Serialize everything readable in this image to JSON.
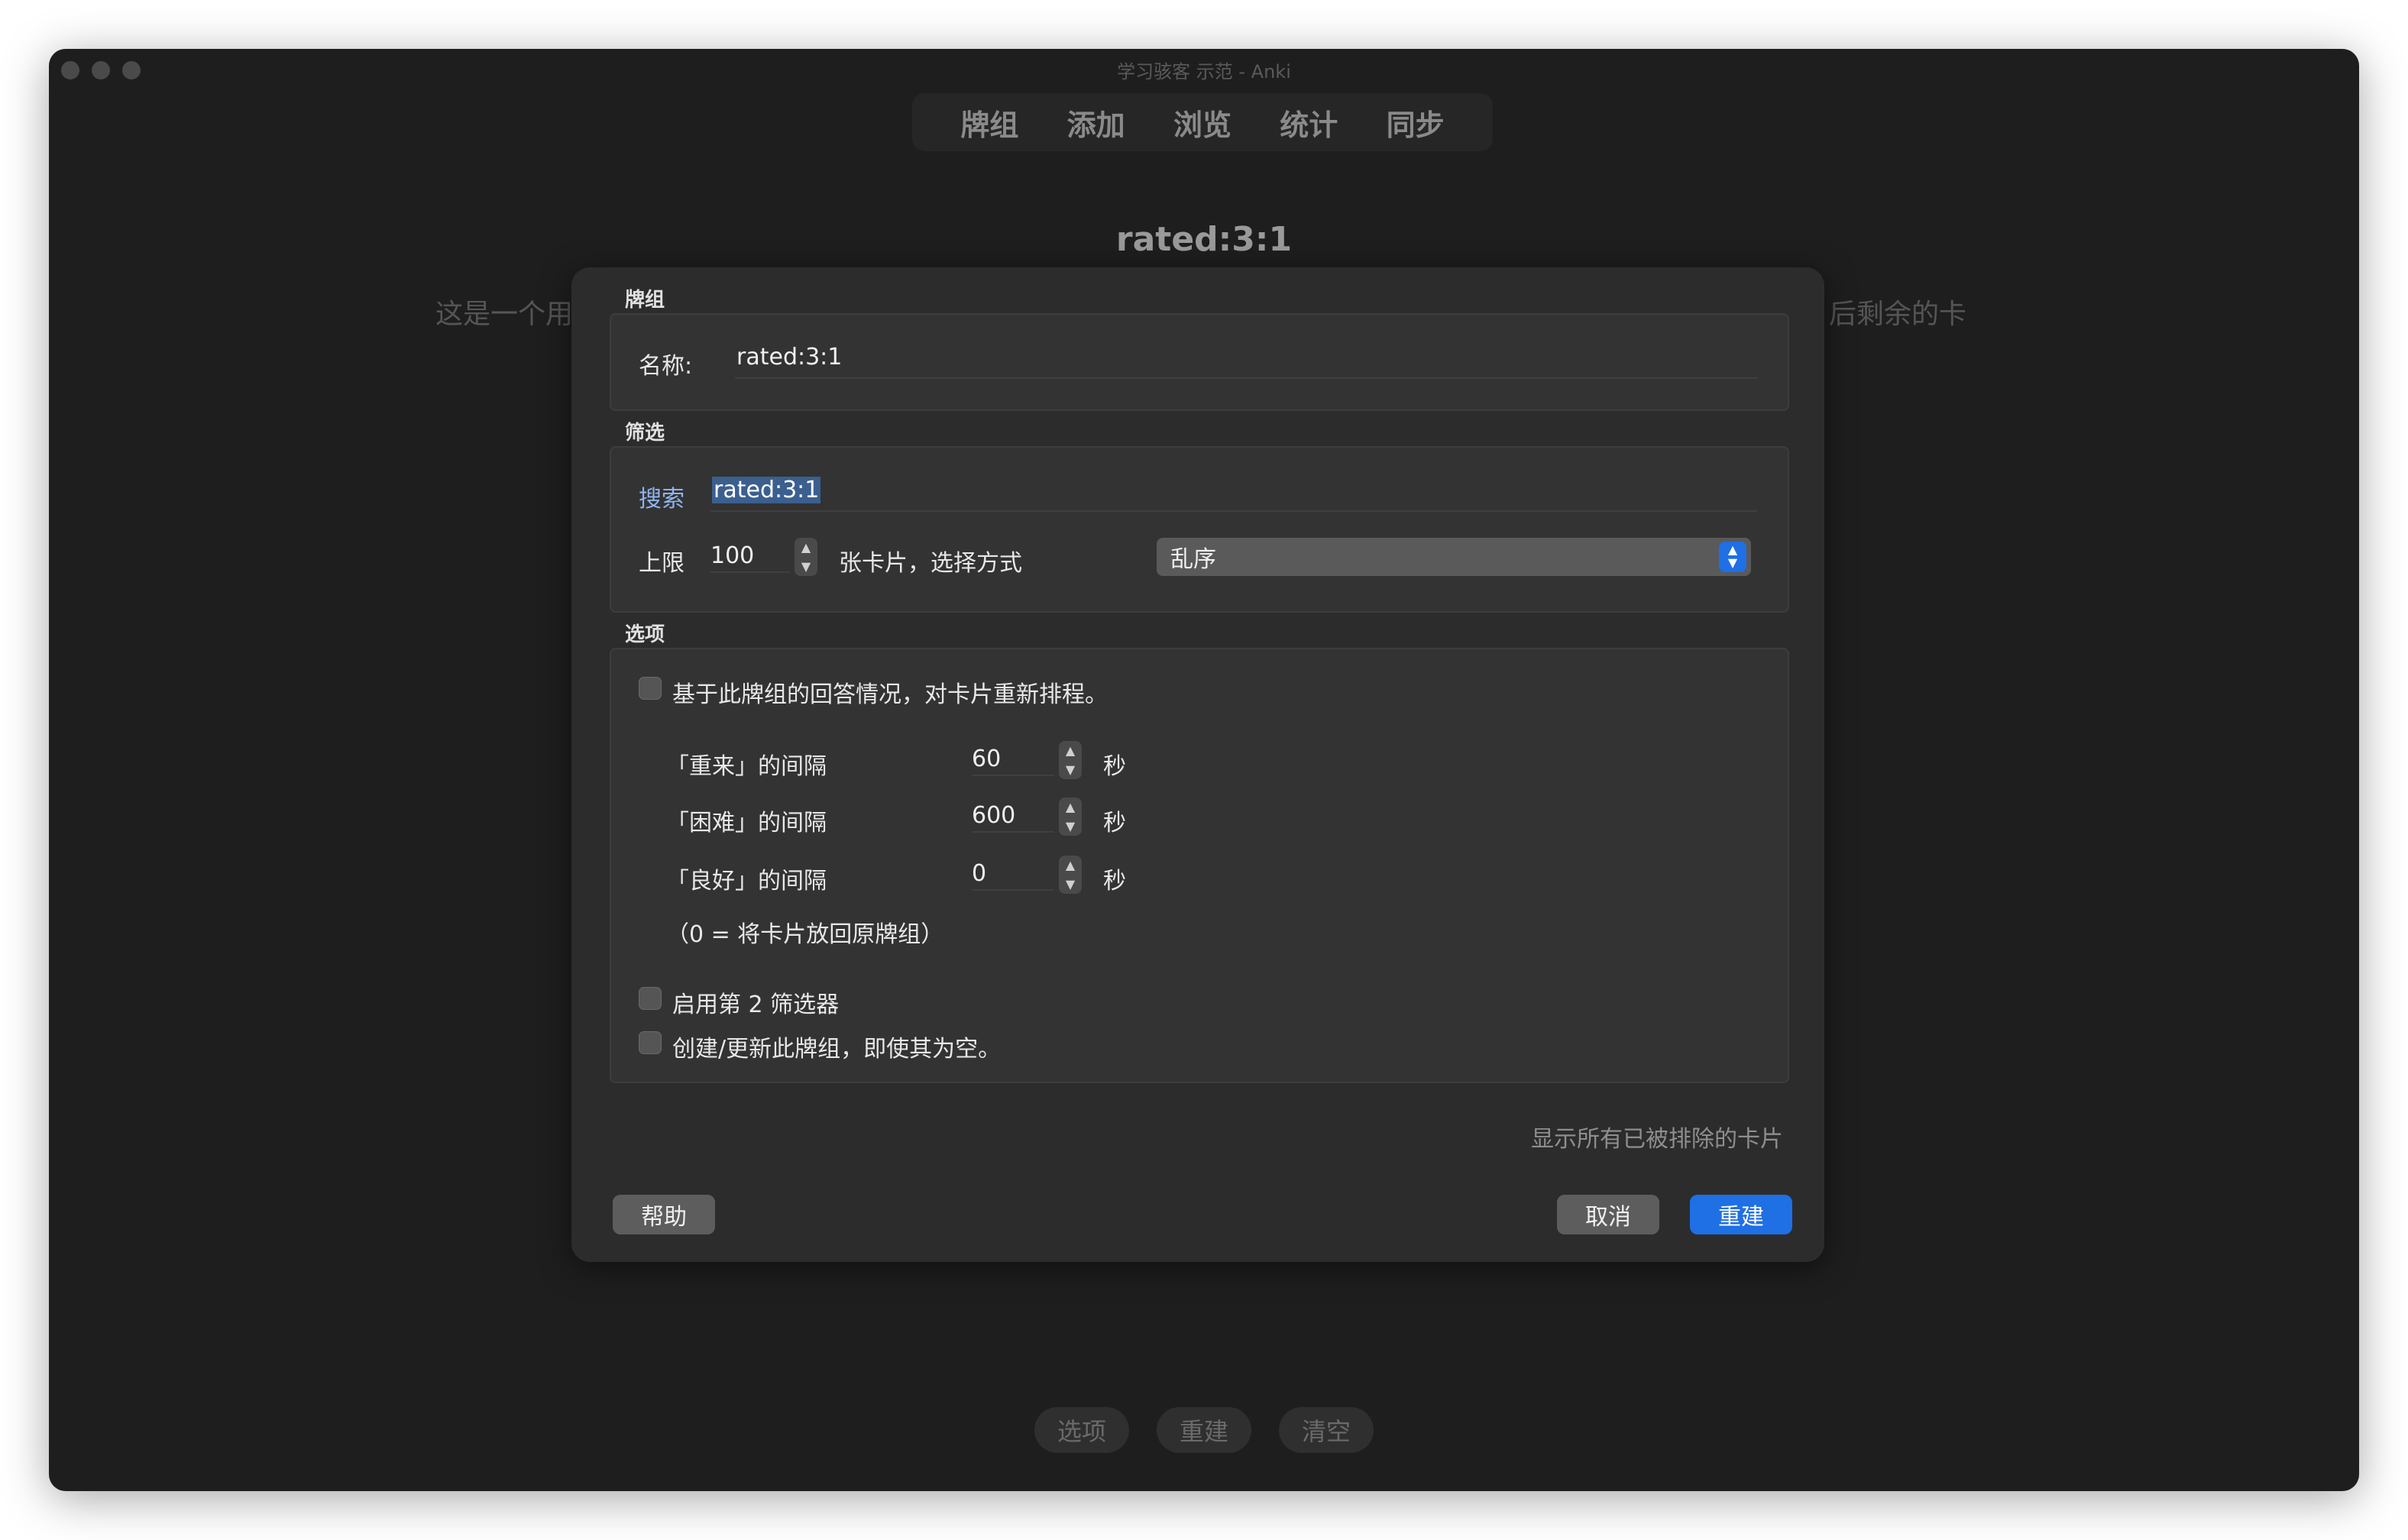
{
  "window": {
    "title": "学习骇客 示范 - Anki"
  },
  "toolbar": {
    "items": [
      "牌组",
      "添加",
      "浏览",
      "统计",
      "同步"
    ]
  },
  "background": {
    "deck_title": "rated:3:1",
    "desc_left": "这是一个用",
    "desc_right": "后剩余的卡",
    "bottom_buttons": [
      "选项",
      "重建",
      "清空"
    ]
  },
  "dialog": {
    "deck_section": {
      "label": "牌组",
      "name_label": "名称:",
      "name_value": "rated:3:1"
    },
    "filter_section": {
      "label": "筛选",
      "search_label": "搜索",
      "search_value": "rated:3:1",
      "limit_label": "上限",
      "limit_value": "100",
      "limit_suffix": "张卡片，选择方式",
      "order_value": "乱序"
    },
    "options_section": {
      "label": "选项",
      "reschedule_label": "基于此牌组的回答情况，对卡片重新排程。",
      "intervals": [
        {
          "label": "「重来」的间隔",
          "value": "60",
          "unit": "秒"
        },
        {
          "label": "「困难」的间隔",
          "value": "600",
          "unit": "秒"
        },
        {
          "label": "「良好」的间隔",
          "value": "0",
          "unit": "秒"
        }
      ],
      "interval_note": "（0 = 将卡片放回原牌组）",
      "second_filter_label": "启用第 2 筛选器",
      "create_empty_label": "创建/更新此牌组，即使其为空。"
    },
    "show_excluded_link": "显示所有已被排除的卡片",
    "buttons": {
      "help": "帮助",
      "cancel": "取消",
      "rebuild": "重建"
    }
  }
}
